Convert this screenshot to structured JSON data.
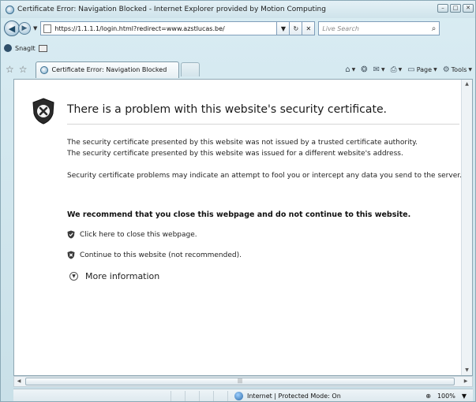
{
  "window": {
    "title": "Certificate Error: Navigation Blocked - Internet Explorer provided by Motion Computing",
    "controls": {
      "minimize": "–",
      "maximize": "□",
      "close": "✕"
    }
  },
  "address_bar": {
    "url": "https://1.1.1.1/login.html?redirect=www.azstlucas.be/",
    "refresh": "↻",
    "stop": "✕",
    "search_placeholder": "Live Search",
    "search_icon": "magnifier-icon"
  },
  "links_bar": {
    "snagit_label": "SnagIt"
  },
  "tab": {
    "label": "Certificate Error: Navigation Blocked"
  },
  "command_bar": {
    "page_label": "Page",
    "tools_label": "Tools"
  },
  "content": {
    "heading": "There is a problem with this website's security certificate.",
    "paragraph1_line1": "The security certificate presented by this website was not issued by a trusted certificate authority.",
    "paragraph1_line2": "The security certificate presented by this website was issued for a different website's address.",
    "paragraph2": "Security certificate problems may indicate an attempt to fool you or intercept any data you send to the server.",
    "recommendation": "We recommend that you close this webpage and do not continue to this website.",
    "close_link": "Click here to close this webpage.",
    "continue_link": "Continue to this website (not recommended).",
    "more_info": "More information"
  },
  "status_bar": {
    "zone": "Internet | Protected Mode: On",
    "zoom": "100%"
  },
  "colors": {
    "shield_dark": "#2a2a2a",
    "window_frame": "#cfe6ee",
    "content_bg": "#ffffff"
  }
}
